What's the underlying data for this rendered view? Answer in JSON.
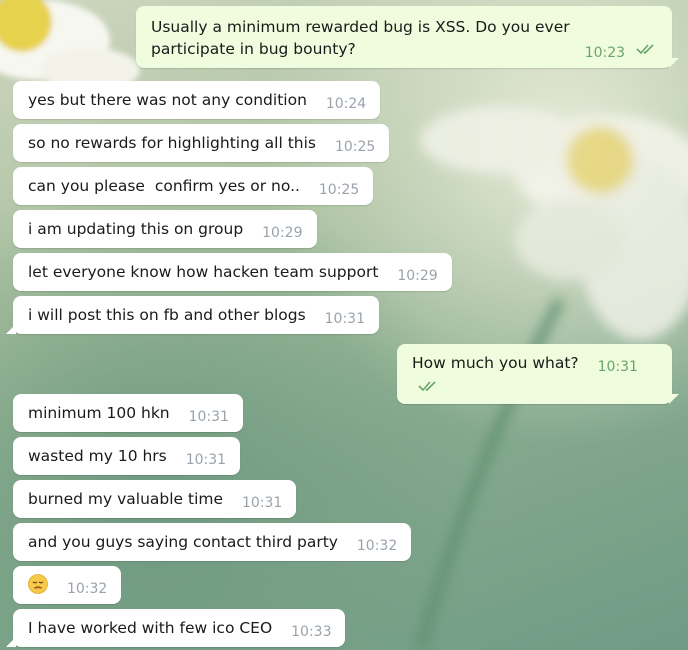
{
  "messages": [
    {
      "dir": "out",
      "text": "Usually a minimum rewarded bug is XSS. Do you ever participate in bug bounty?",
      "time": "10:23",
      "read": true
    },
    {
      "dir": "in",
      "text": "yes but there was not any condition",
      "time": "10:24"
    },
    {
      "dir": "in",
      "text": "so no rewards for highlighting all this",
      "time": "10:25"
    },
    {
      "dir": "in",
      "text": "can you please  confirm yes or no..",
      "time": "10:25"
    },
    {
      "dir": "in",
      "text": "i am updating this on group",
      "time": "10:29"
    },
    {
      "dir": "in",
      "text": "let everyone know how hacken team support",
      "time": "10:29"
    },
    {
      "dir": "in",
      "text": "i will post this on fb and other blogs",
      "time": "10:31"
    },
    {
      "dir": "out",
      "text": "How much you what?",
      "time": "10:31",
      "read": true
    },
    {
      "dir": "in",
      "text": "minimum 100 hkn",
      "time": "10:31"
    },
    {
      "dir": "in",
      "text": "wasted my 10 hrs",
      "time": "10:31"
    },
    {
      "dir": "in",
      "text": "burned my valuable time",
      "time": "10:31"
    },
    {
      "dir": "in",
      "text": "and you guys saying contact third party",
      "time": "10:32"
    },
    {
      "dir": "in",
      "emoji": "disappointed-face-emoji",
      "time": "10:32"
    },
    {
      "dir": "in",
      "text": "I have worked with few ico CEO",
      "time": "10:33"
    }
  ],
  "colors": {
    "incoming_bubble": "#ffffff",
    "outgoing_bubble": "#effdde",
    "outgoing_time": "#6aa56b",
    "incoming_time": "#9aa3ab"
  }
}
